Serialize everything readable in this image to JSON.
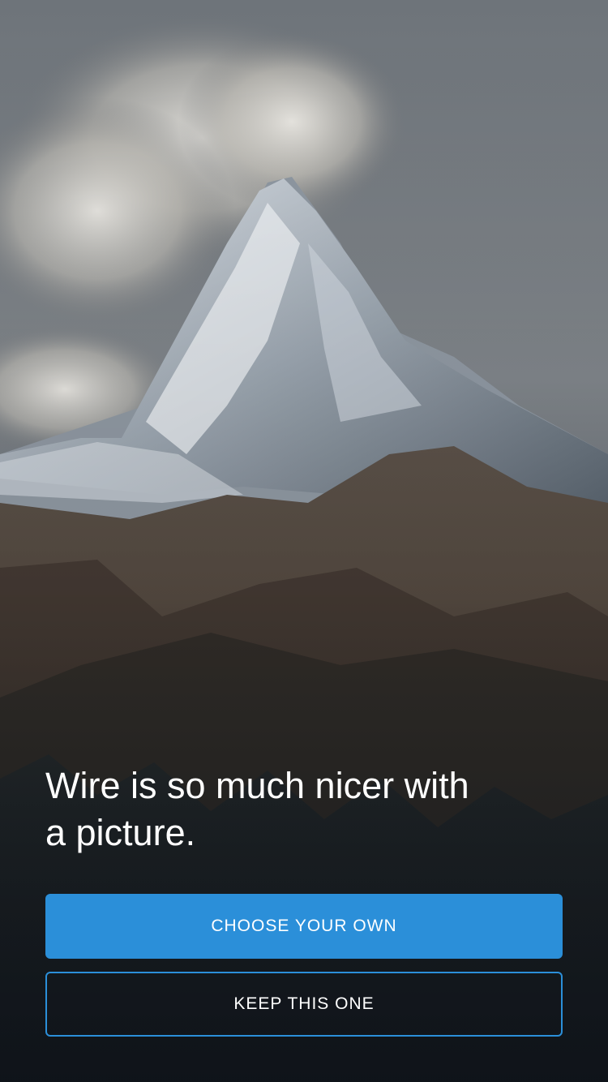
{
  "prompt": {
    "headline": "Wire is so much nicer with a picture."
  },
  "actions": {
    "choose_label": "CHOOSE YOUR OWN",
    "keep_label": "KEEP THIS ONE"
  },
  "colors": {
    "accent": "#2b8fd9",
    "text": "#ffffff"
  },
  "background_icon": "mountain-photo"
}
